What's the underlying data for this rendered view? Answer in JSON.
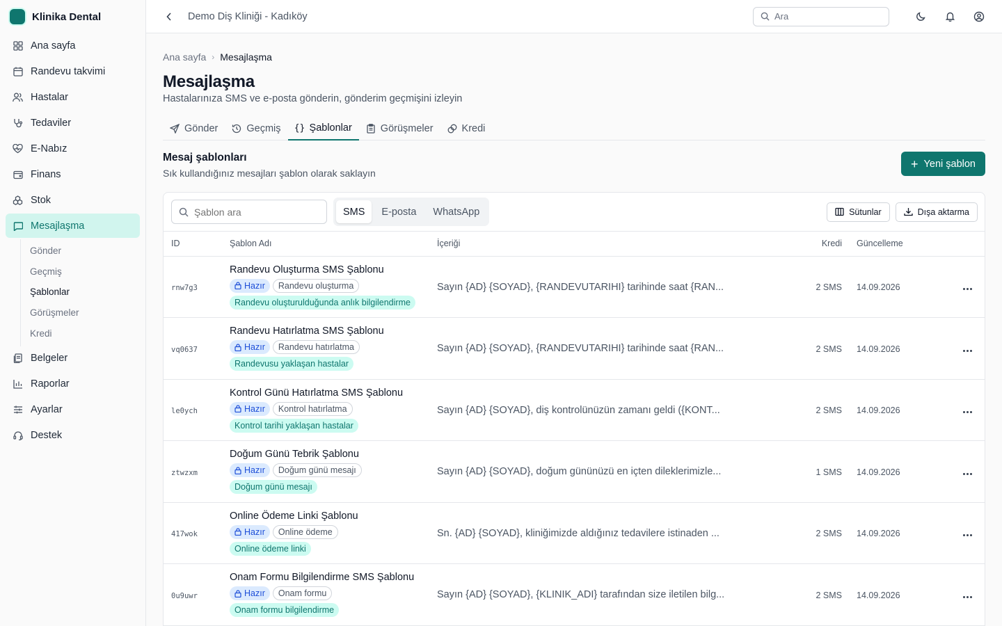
{
  "brand": {
    "name": "Klinika Dental",
    "color": "#0f766e"
  },
  "sidebar": {
    "items": [
      {
        "label": "Ana sayfa",
        "icon": "grid-icon"
      },
      {
        "label": "Randevu takvimi",
        "icon": "calendar-icon"
      },
      {
        "label": "Hastalar",
        "icon": "users-icon"
      },
      {
        "label": "Tedaviler",
        "icon": "stethoscope-icon"
      },
      {
        "label": "E-Nabız",
        "icon": "heart-pulse-icon"
      },
      {
        "label": "Finans",
        "icon": "wallet-icon"
      },
      {
        "label": "Stok",
        "icon": "boxes-icon"
      },
      {
        "label": "Mesajlaşma",
        "icon": "message-icon",
        "active": true
      },
      {
        "label": "Belgeler",
        "icon": "documents-icon"
      },
      {
        "label": "Raporlar",
        "icon": "bar-chart-icon"
      },
      {
        "label": "Ayarlar",
        "icon": "sliders-icon"
      },
      {
        "label": "Destek",
        "icon": "headset-icon"
      }
    ],
    "sub_items": [
      "Gönder",
      "Geçmiş",
      "Şablonlar",
      "Görüşmeler",
      "Kredi"
    ],
    "active_sub": "Şablonlar"
  },
  "topbar": {
    "clinic": "Demo Diş Kliniği - Kadıköy",
    "search_placeholder": "Ara"
  },
  "breadcrumb": {
    "root": "Ana sayfa",
    "current": "Mesajlaşma"
  },
  "page": {
    "title": "Mesajlaşma",
    "subtitle": "Hastalarınıza SMS ve e-posta gönderin, gönderim geçmişini izleyin"
  },
  "tabs": [
    {
      "label": "Gönder",
      "icon": "send-icon"
    },
    {
      "label": "Geçmiş",
      "icon": "history-icon"
    },
    {
      "label": "Şablonlar",
      "icon": "braces-icon",
      "active": true
    },
    {
      "label": "Görüşmeler",
      "icon": "clipboard-icon"
    },
    {
      "label": "Kredi",
      "icon": "coins-icon"
    }
  ],
  "section": {
    "title": "Mesaj şablonları",
    "subtitle": "Sık kullandığınız mesajları şablon olarak saklayın",
    "new_button": "Yeni şablon"
  },
  "toolbar": {
    "search_placeholder": "Şablon ara",
    "channels": [
      "SMS",
      "E-posta",
      "WhatsApp"
    ],
    "active_channel": "SMS",
    "columns_button": "Sütunlar",
    "export_button": "Dışa aktarma"
  },
  "table": {
    "headers": {
      "id": "ID",
      "name": "Şablon Adı",
      "content": "İçeriği",
      "credit": "Kredi",
      "updated": "Güncelleme"
    },
    "rows": [
      {
        "id": "rnw7g3",
        "name": "Randevu Oluşturma SMS Şablonu",
        "status": "Hazır",
        "category": "Randevu oluşturma",
        "tag": "Randevu oluşturulduğunda anlık bilgilendirme",
        "content": "Sayın {AD} {SOYAD}, {RANDEVUTARIHI} tarihinde saat {RAN...",
        "credit": "2 SMS",
        "updated": "14.09.2026"
      },
      {
        "id": "vq0637",
        "name": "Randevu Hatırlatma SMS Şablonu",
        "status": "Hazır",
        "category": "Randevu hatırlatma",
        "tag": "Randevusu yaklaşan hastalar",
        "content": "Sayın {AD} {SOYAD}, {RANDEVUTARIHI} tarihinde saat {RAN...",
        "credit": "2 SMS",
        "updated": "14.09.2026"
      },
      {
        "id": "le0ych",
        "name": "Kontrol Günü Hatırlatma SMS Şablonu",
        "status": "Hazır",
        "category": "Kontrol hatırlatma",
        "tag": "Kontrol tarihi yaklaşan hastalar",
        "content": "Sayın {AD} {SOYAD}, diş kontrolünüzün zamanı geldi ({KONT...",
        "credit": "2 SMS",
        "updated": "14.09.2026"
      },
      {
        "id": "ztwzxm",
        "name": "Doğum Günü Tebrik Şablonu",
        "status": "Hazır",
        "category": "Doğum günü mesajı",
        "tag": "Doğum günü mesajı",
        "content": "Sayın {AD} {SOYAD}, doğum gününüzü en içten dileklerimizle...",
        "credit": "1 SMS",
        "updated": "14.09.2026"
      },
      {
        "id": "417wok",
        "name": "Online Ödeme Linki Şablonu",
        "status": "Hazır",
        "category": "Online ödeme",
        "tag": "Online ödeme linki",
        "content": "Sn. {AD} {SOYAD}, kliniğimizde aldığınız tedavilere istinaden ...",
        "credit": "2 SMS",
        "updated": "14.09.2026"
      },
      {
        "id": "0u9uwr",
        "name": "Onam Formu Bilgilendirme SMS Şablonu",
        "status": "Hazır",
        "category": "Onam formu",
        "tag": "Onam formu bilgilendirme",
        "content": "Sayın {AD} {SOYAD}, {KLINIK_ADI} tarafından size iletilen bilg...",
        "credit": "2 SMS",
        "updated": "14.09.2026"
      }
    ]
  }
}
